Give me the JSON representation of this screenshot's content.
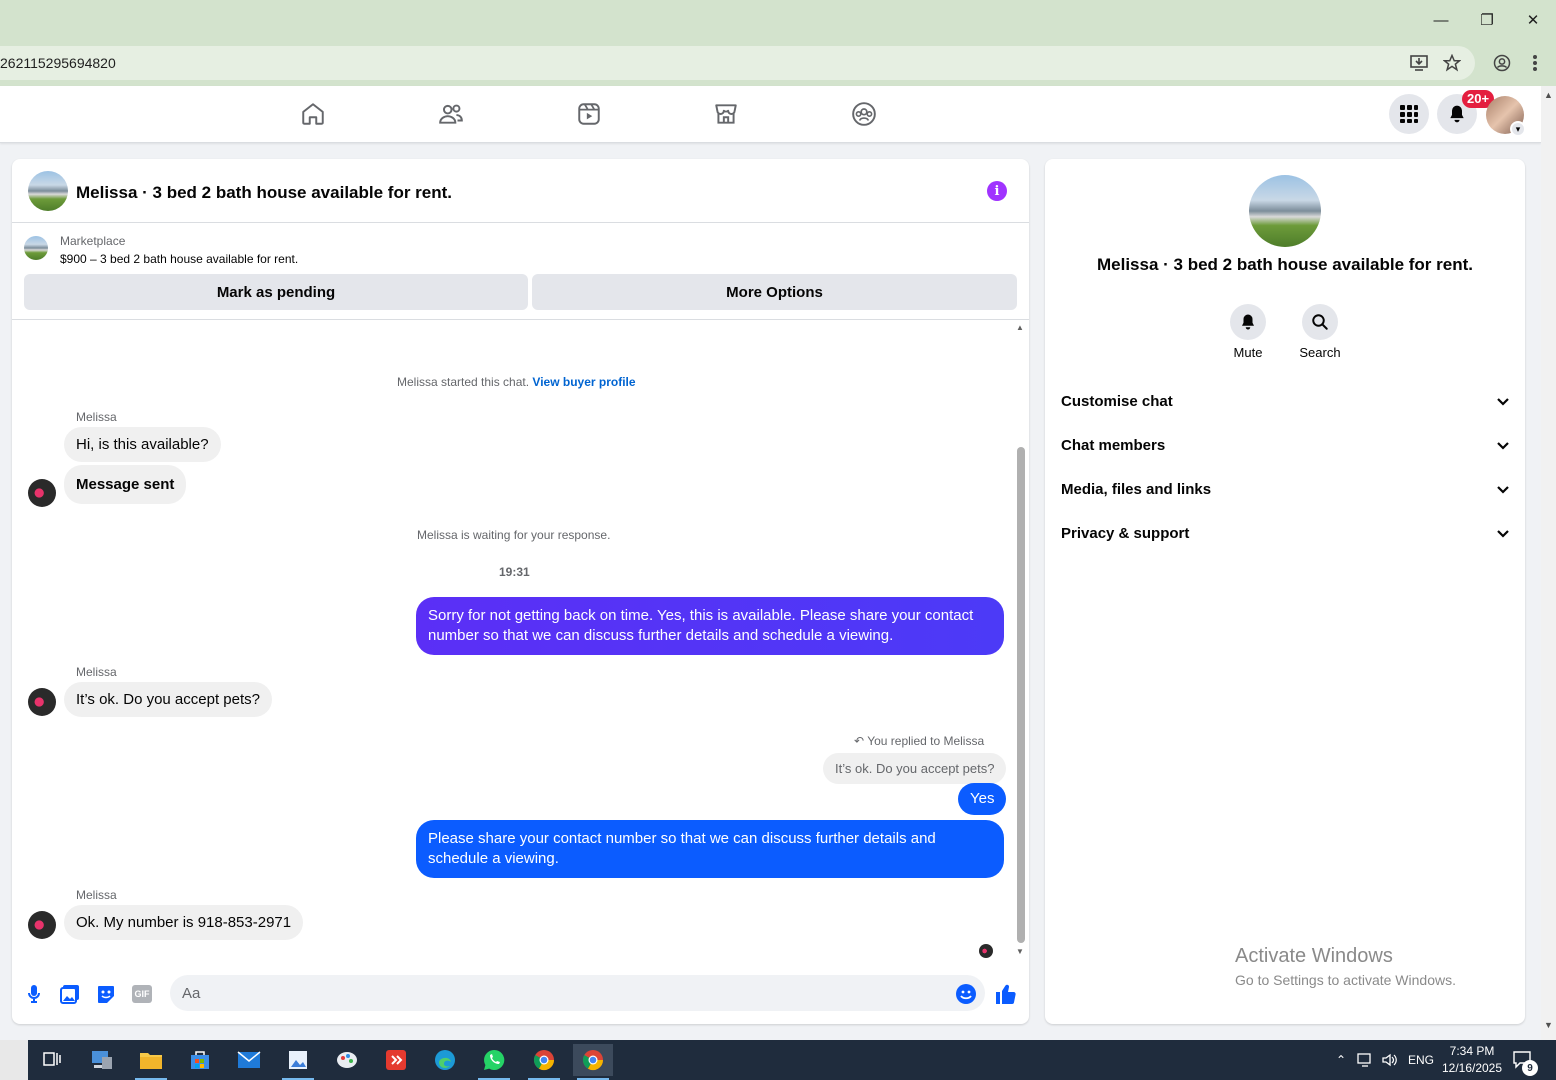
{
  "browser": {
    "url": "262115295694820"
  },
  "topbar": {
    "notifications_badge": "20+",
    "nav": [
      "home-icon",
      "friends-icon",
      "video-icon",
      "marketplace-icon",
      "groups-icon"
    ]
  },
  "chat": {
    "title": "Melissa · 3 bed 2 bath house available for rent.",
    "listing": {
      "label": "Marketplace",
      "price_title": "$900 – 3 bed 2 bath house available for rent.",
      "mark_pending": "Mark as pending",
      "more_options": "More Options"
    },
    "started_text": "Melissa started this chat.",
    "view_buyer": "View buyer profile",
    "messages": [
      {
        "sender": "Melissa",
        "text": "Hi, is this available?"
      },
      {
        "text": "Message sent"
      },
      {
        "text": "Melissa is waiting for your response."
      },
      {
        "text": "19:31"
      },
      {
        "text": "Sorry for not getting back on time. Yes, this is available. Please share your contact number so that we can discuss further details and schedule a viewing."
      },
      {
        "sender": "Melissa",
        "text": "It’s ok. Do you accept pets?"
      },
      {
        "text": "You replied to Melissa"
      },
      {
        "text": "It’s ok. Do you accept pets?"
      },
      {
        "text": "Yes"
      },
      {
        "text": "Please share your contact number so that we can discuss further details and schedule a viewing."
      },
      {
        "sender": "Melissa",
        "text": "Ok. My number is 918-853-2971"
      }
    ],
    "composer_placeholder": "Aa",
    "gif_label": "GIF"
  },
  "info": {
    "title": "Melissa · 3 bed 2 bath house available for rent.",
    "mute": "Mute",
    "search": "Search",
    "sections": [
      "Customise chat",
      "Chat members",
      "Media, files and links",
      "Privacy & support"
    ]
  },
  "watermark": {
    "line1": "Activate Windows",
    "line2": "Go to Settings to activate Windows."
  },
  "taskbar": {
    "lang": "ENG",
    "time": "7:34 PM",
    "date": "12/16/2025",
    "notif_count": "9"
  },
  "colors": {
    "accent": "#0b5cff",
    "purple": "#a033ff",
    "badge": "#e41e3f"
  }
}
